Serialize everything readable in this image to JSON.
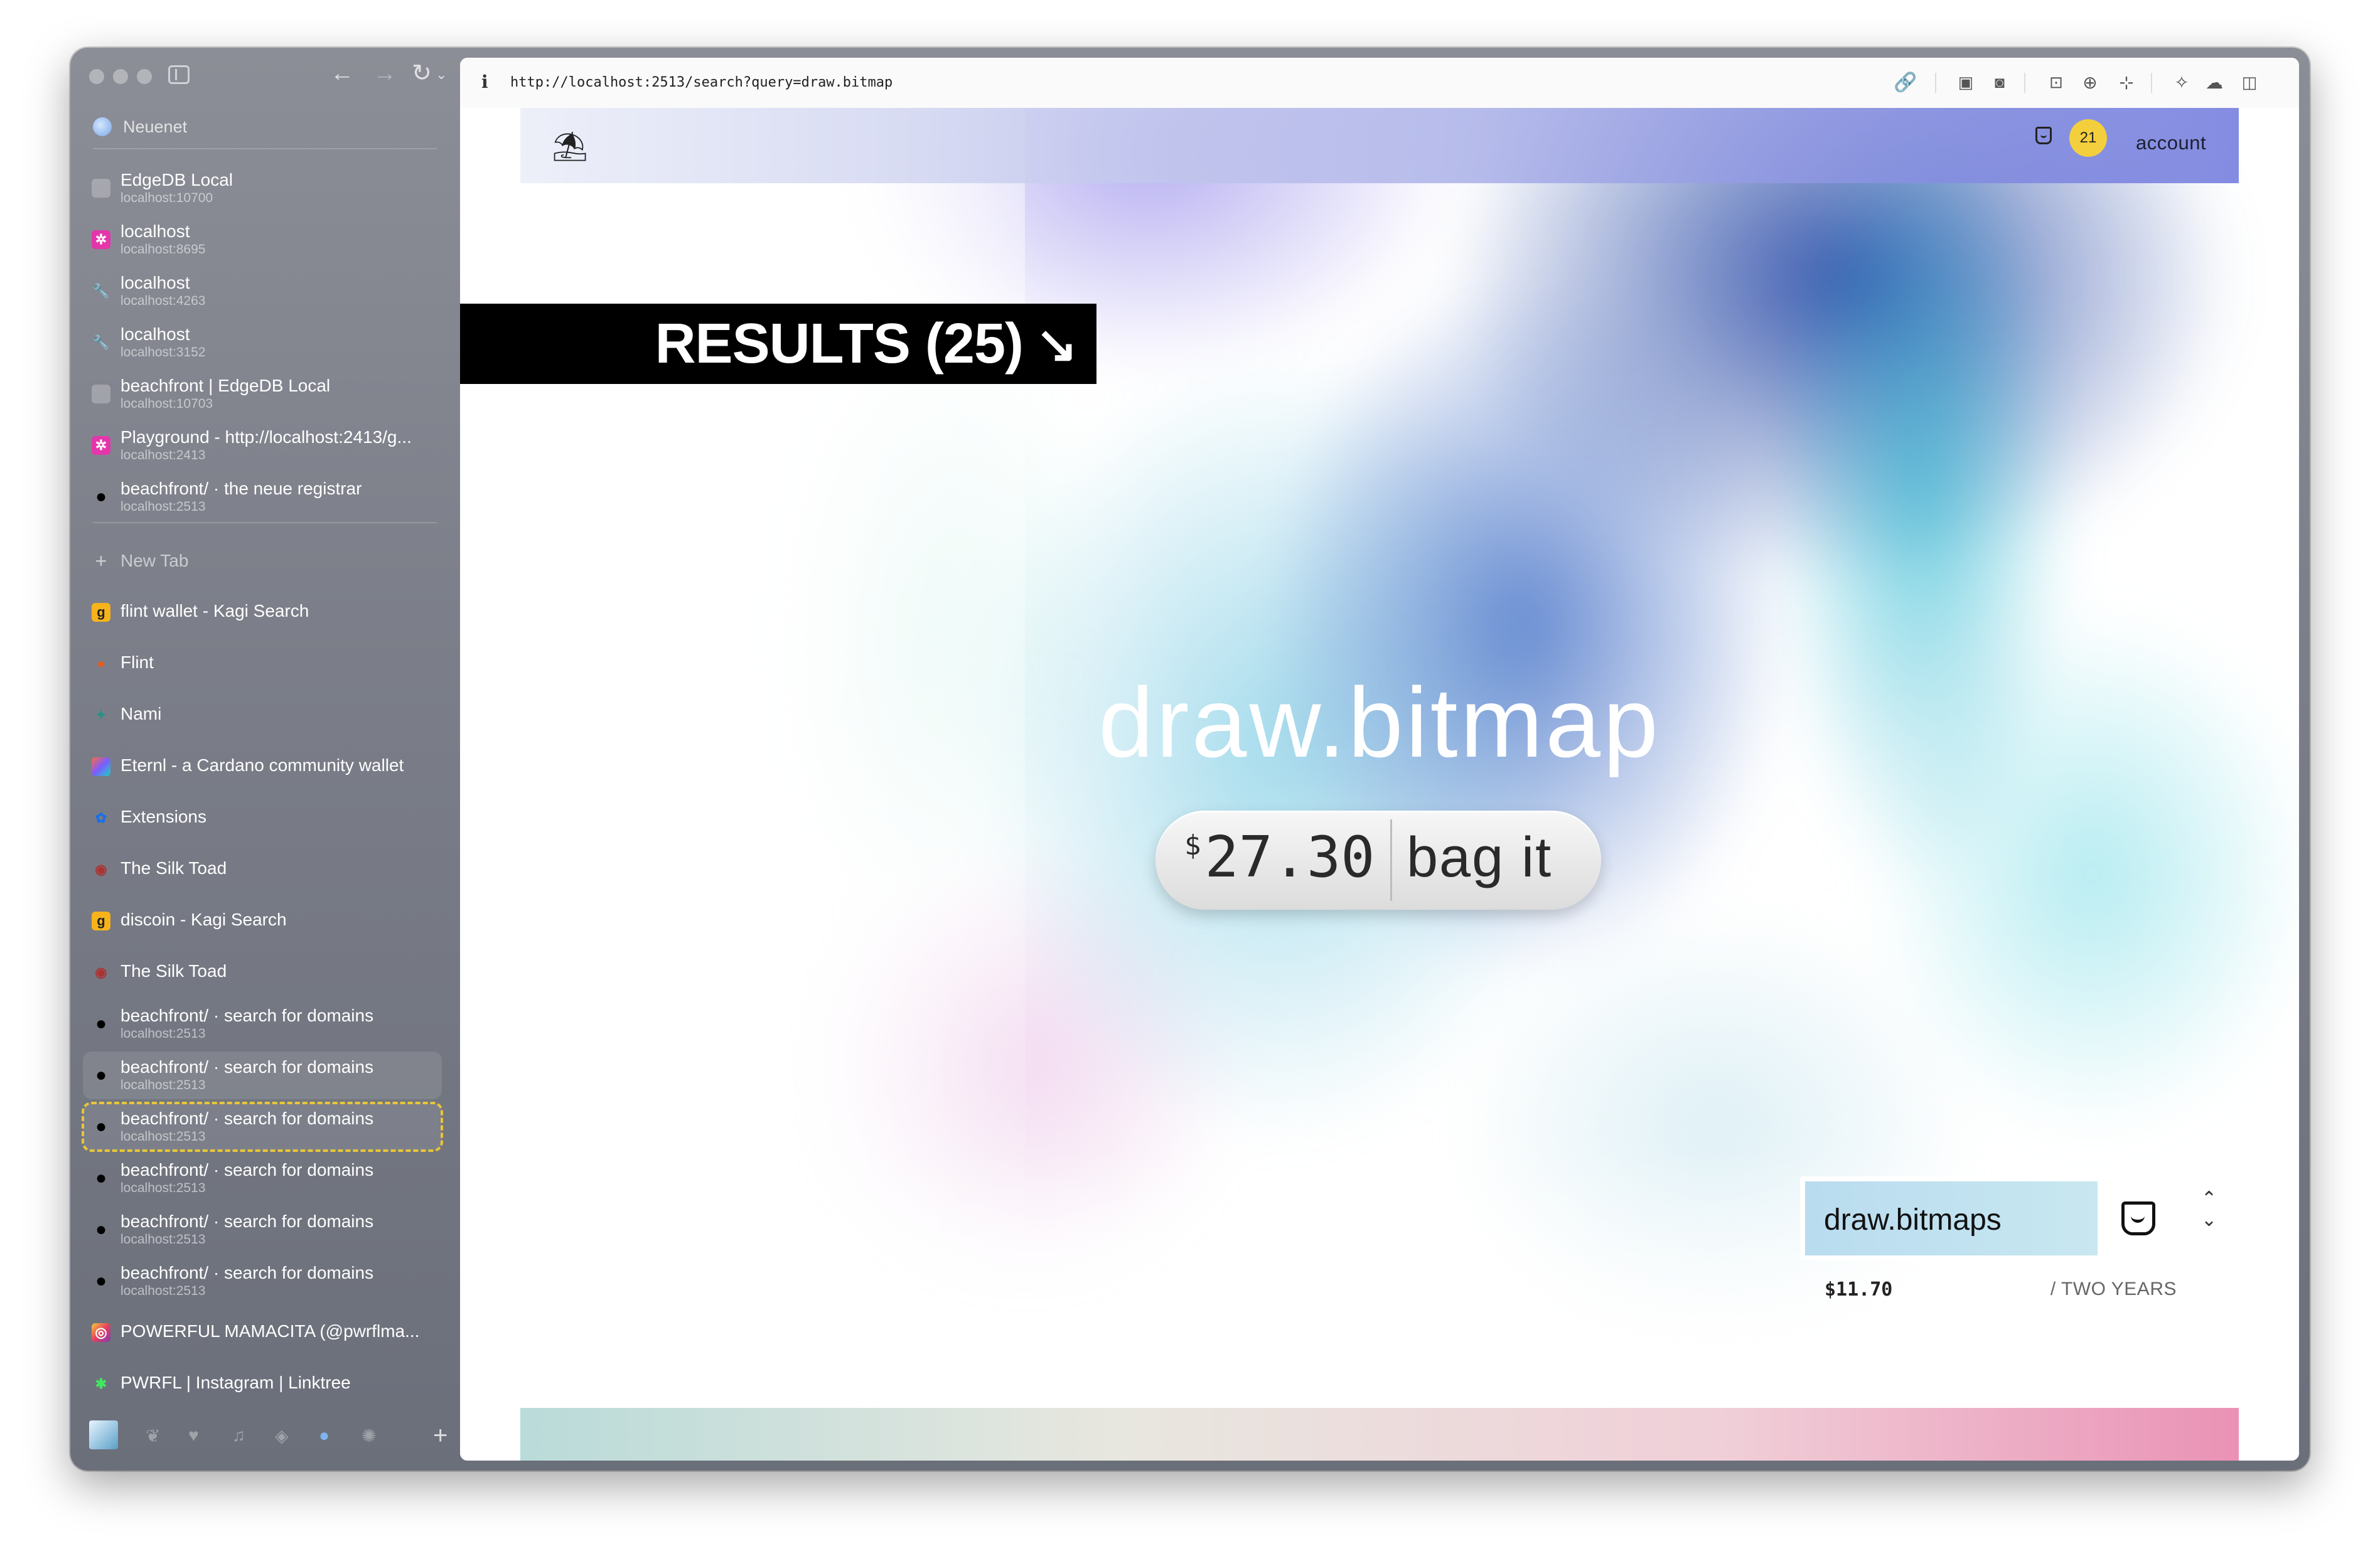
{
  "sidebar": {
    "space_name": "Neuenet",
    "pinned": [
      {
        "title": "EdgeDB Local",
        "sub": "localhost:10700",
        "icon": "edgedb-icon"
      },
      {
        "title": "localhost",
        "sub": "localhost:8695",
        "icon": "graphql-icon"
      },
      {
        "title": "localhost",
        "sub": "localhost:4263",
        "icon": "wrench-icon"
      },
      {
        "title": "localhost",
        "sub": "localhost:3152",
        "icon": "wrench-icon"
      },
      {
        "title": "beachfront | EdgeDB Local",
        "sub": "localhost:10703",
        "icon": "edgedb-icon"
      },
      {
        "title": "Playground - http://localhost:2413/g...",
        "sub": "localhost:2413",
        "icon": "graphql-icon"
      },
      {
        "title": "beachfront/ · the neue registrar",
        "sub": "localhost:2513",
        "icon": "dot-icon"
      }
    ],
    "new_tab_label": "New Tab",
    "tabs": [
      {
        "title": "flint wallet - Kagi Search",
        "icon": "kagi-icon"
      },
      {
        "title": "Flint",
        "icon": "flint-icon"
      },
      {
        "title": "Nami",
        "icon": "nami-icon"
      },
      {
        "title": "Eternl - a Cardano community wallet",
        "icon": "eternl-icon"
      },
      {
        "title": "Extensions",
        "icon": "extensions-icon"
      },
      {
        "title": "The Silk Toad",
        "icon": "toad-icon"
      },
      {
        "title": "discoin - Kagi Search",
        "icon": "kagi-icon"
      },
      {
        "title": "The Silk Toad",
        "icon": "toad-icon"
      },
      {
        "title": "beachfront/ · search for domains",
        "sub": "localhost:2513",
        "icon": "dot-icon"
      },
      {
        "title": "beachfront/ · search for domains",
        "sub": "localhost:2513",
        "icon": "dot-icon"
      },
      {
        "title": "beachfront/ · search for domains",
        "sub": "localhost:2513",
        "icon": "dot-icon"
      },
      {
        "title": "beachfront/ · search for domains",
        "sub": "localhost:2513",
        "icon": "dot-icon"
      },
      {
        "title": "beachfront/ · search for domains",
        "sub": "localhost:2513",
        "icon": "dot-icon"
      },
      {
        "title": "beachfront/ · search for domains",
        "sub": "localhost:2513",
        "icon": "dot-icon"
      },
      {
        "title": "POWERFUL MAMACITA (@pwrflma...",
        "icon": "instagram-icon"
      },
      {
        "title": "PWRFL | Instagram | Linktree",
        "icon": "linktree-icon"
      }
    ]
  },
  "toolbar": {
    "url": "http://localhost:2513/search?query=draw.bitmap",
    "info_glyph": "i"
  },
  "site": {
    "cart_count": "21",
    "account_label": "account",
    "results_label": "RESULTS (25)",
    "results_arrow": "↘",
    "domain": "draw.bitmap",
    "price_symbol": "$",
    "price": "27.30",
    "bag_label": "bag it",
    "result": {
      "name": "draw.bitmaps",
      "price": "$11.70",
      "term": "/ TWO YEARS"
    }
  },
  "colors": {
    "accent_badge": "#f4cf3d",
    "results_banner": "#000000",
    "sidebar": "#7c7f89"
  }
}
